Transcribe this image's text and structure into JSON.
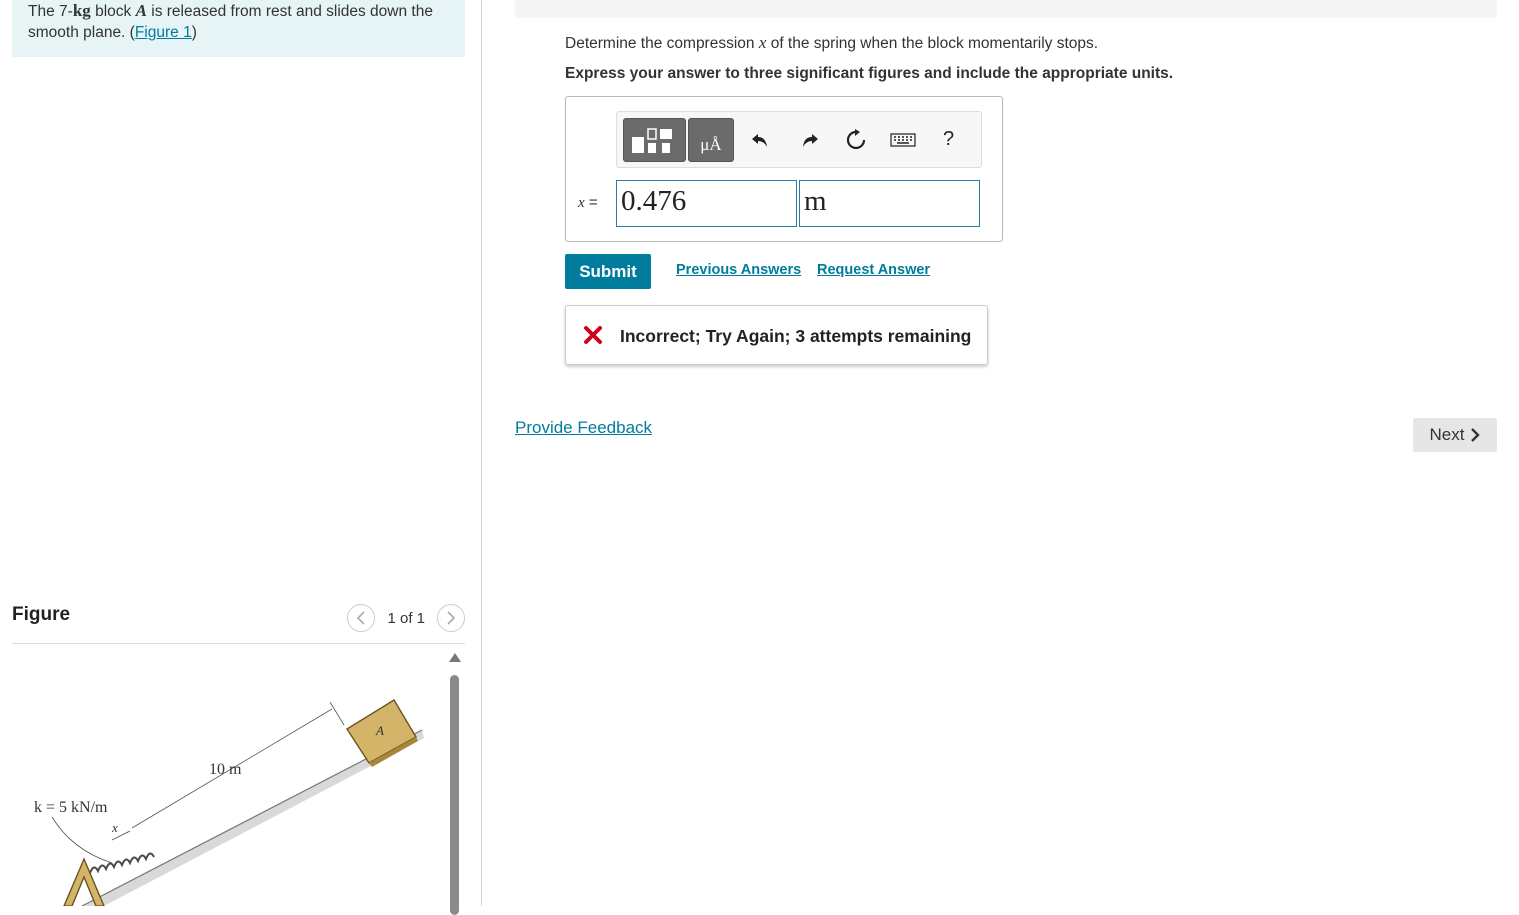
{
  "problem": {
    "text_1": "The 7-",
    "kg": "kg",
    "text_2": " block ",
    "block_var": "A",
    "text_3": " is released from rest and slides down the smooth plane. (",
    "figure_link": "Figure 1",
    "text_4": ")"
  },
  "figure_panel": {
    "title": "Figure",
    "pager": "1 of 1",
    "prev_icon": "chevron-left-icon",
    "next_icon": "chevron-right-icon",
    "labels": {
      "distance": "10 m",
      "spring_k": "k = 5 kN/m",
      "compression": "x",
      "block": "A"
    }
  },
  "question": {
    "text_1": "Determine the compression ",
    "var": "x",
    "text_2": " of the spring when the block momentarily stops.",
    "instruction": "Express your answer to three significant figures and include the appropriate units."
  },
  "answer": {
    "label_var": "x",
    "label_eq": " =",
    "value": "0.476",
    "unit": "m",
    "toolbar": {
      "templates_icon": "templates-icon",
      "units_label": "μÅ",
      "undo_icon": "undo-icon",
      "redo_icon": "redo-icon",
      "reset_icon": "reset-icon",
      "keyboard_icon": "keyboard-icon",
      "help_label": "?"
    }
  },
  "actions": {
    "submit": "Submit",
    "previous_answers": "Previous Answers",
    "request_answer": "Request Answer"
  },
  "feedback": {
    "status": "Incorrect; Try Again; 3 attempts remaining",
    "status_color": "#d0021b"
  },
  "footer": {
    "provide_feedback": "Provide Feedback",
    "next": "Next"
  },
  "colors": {
    "accent": "#007c9c",
    "problem_bg": "#e6f4f6"
  }
}
